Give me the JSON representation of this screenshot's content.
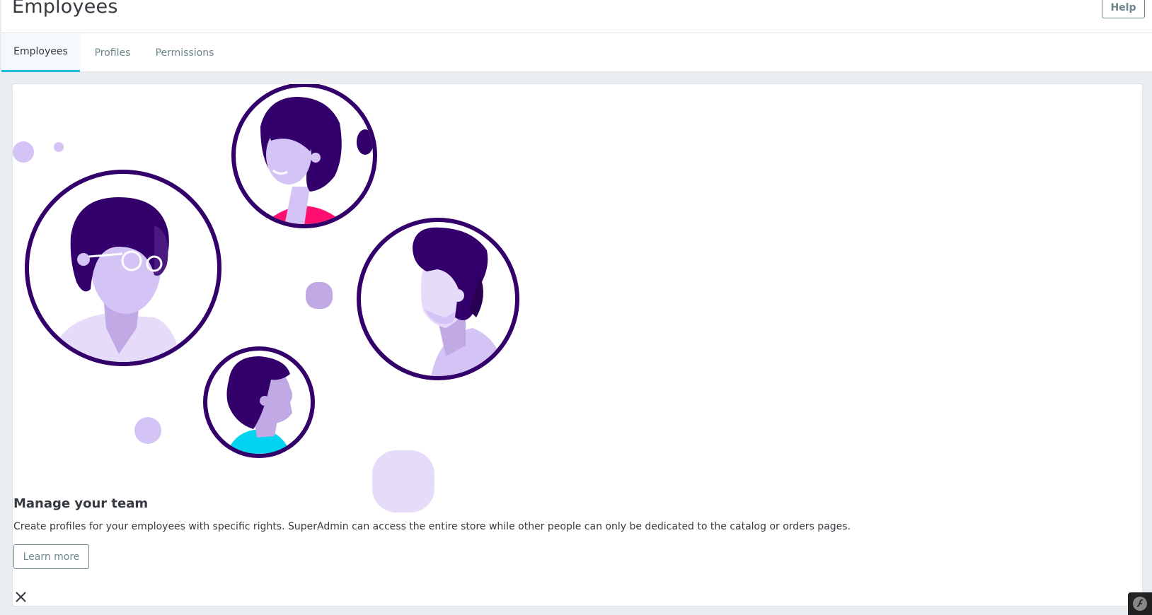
{
  "header": {
    "title": "Employees",
    "help_label": "Help"
  },
  "tabs": [
    {
      "label": "Employees",
      "active": true
    },
    {
      "label": "Profiles",
      "active": false
    },
    {
      "label": "Permissions",
      "active": false
    }
  ],
  "card": {
    "title": "Manage your team",
    "description": "Create profiles for your employees with specific rights. SuperAdmin can access the entire store while other people can only be dedicated to the catalog or orders pages.",
    "learn_more_label": "Learn more"
  },
  "icons": {
    "close": "close-icon",
    "symfony": "symfony-icon"
  },
  "colors": {
    "accent": "#25b9d7",
    "illustration_dark": "#33006b",
    "illustration_light": "#d4c3f5",
    "pink": "#ff0f6f",
    "cyan": "#00d4f0"
  }
}
